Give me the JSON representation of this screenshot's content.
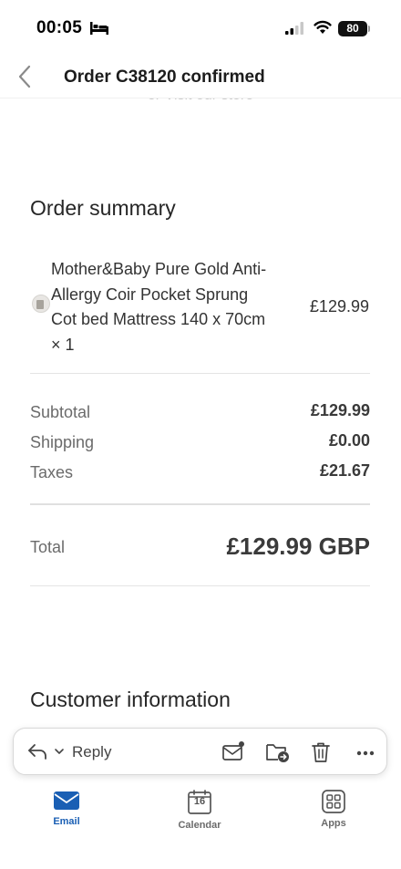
{
  "status_bar": {
    "time": "00:05",
    "battery": "80"
  },
  "nav": {
    "title": "Order C38120 confirmed",
    "peek_text": "or Visit our store"
  },
  "order_summary": {
    "title": "Order summary",
    "item": {
      "name": "Mother&Baby Pure Gold Anti-Allergy Coir Pocket Sprung Cot bed Mattress 140 x 70cm × 1",
      "price": "£129.99"
    },
    "subtotal_label": "Subtotal",
    "subtotal_value": "£129.99",
    "shipping_label": "Shipping",
    "shipping_value": "£0.00",
    "taxes_label": "Taxes",
    "taxes_value": "£21.67",
    "total_label": "Total",
    "total_value": "£129.99 GBP"
  },
  "customer_information": {
    "title": "Customer information"
  },
  "reply_bar": {
    "reply_label": "Reply"
  },
  "tab_bar": {
    "email": "Email",
    "calendar": "Calendar",
    "calendar_day": "16",
    "apps": "Apps"
  },
  "colors": {
    "accent": "#1a5fb4",
    "text": "#262626",
    "muted": "#6b6b6b"
  }
}
